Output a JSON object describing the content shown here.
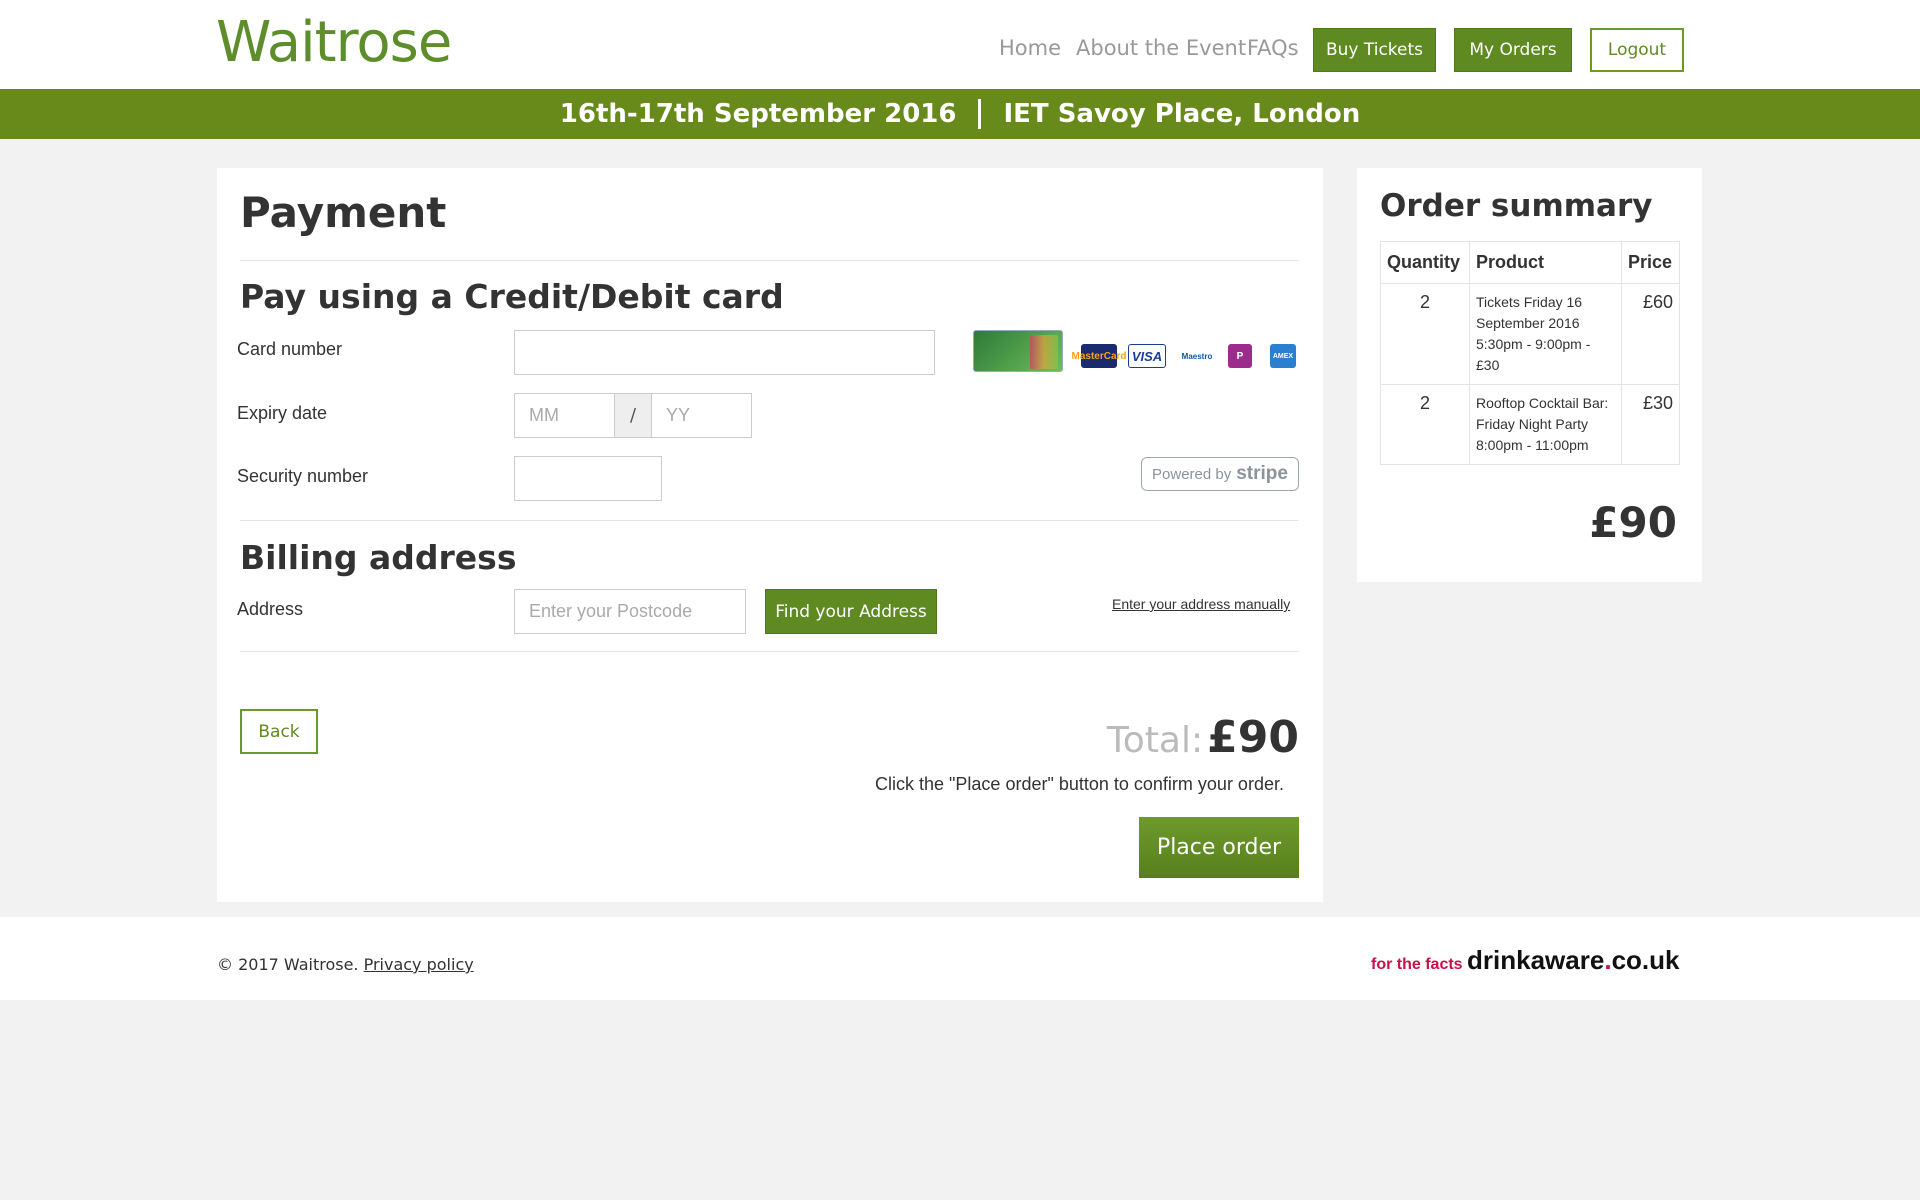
{
  "header": {
    "logo": "Waitrose",
    "nav": [
      "Home",
      "About the Event",
      "FAQs"
    ],
    "buy_tickets": "Buy Tickets",
    "my_orders": "My Orders",
    "logout": "Logout"
  },
  "banner": {
    "dates": "16th-17th September 2016",
    "venue": "IET Savoy Place, London"
  },
  "payment": {
    "title": "Payment",
    "card_heading": "Pay using a Credit/Debit card",
    "card_number_label": "Card number",
    "expiry_label": "Expiry date",
    "expiry_month_placeholder": "MM",
    "expiry_separator": "/",
    "expiry_year_placeholder": "YY",
    "security_label": "Security number",
    "card_icons": [
      "mastercard-icon",
      "visa-icon",
      "maestro-icon",
      "card-icon",
      "amex-icon"
    ],
    "card_icon_labels": [
      "MasterCard",
      "VISA",
      "Maestro",
      "P",
      "AMEX"
    ],
    "stripe_prefix": "Powered by",
    "stripe_name": "stripe",
    "billing_heading": "Billing address",
    "address_label": "Address",
    "postcode_placeholder": "Enter your Postcode",
    "find_address": "Find your Address",
    "manual_address": "Enter your address manually",
    "back": "Back",
    "total_label": "Total:",
    "total_value": "£90",
    "confirm_text": "Click the \"Place order\" button to confirm your order.",
    "place_order": "Place order"
  },
  "summary": {
    "title": "Order summary",
    "columns": [
      "Quantity",
      "Product",
      "Price"
    ],
    "rows": [
      {
        "qty": "2",
        "product": "Tickets Friday 16 September 2016 5:30pm - 9:00pm - £30",
        "price": "£60"
      },
      {
        "qty": "2",
        "product": "Rooftop Cocktail Bar: Friday Night Party 8:00pm - 11:00pm",
        "price": "£30"
      }
    ],
    "total": "£90"
  },
  "footer": {
    "copyright": "© 2017 Waitrose.",
    "privacy": "Privacy policy",
    "drinkaware_prefix": "for the facts",
    "drinkaware_name": "drinkaware",
    "drinkaware_dot": ".",
    "drinkaware_tld": "co.uk"
  },
  "colors": {
    "brand_green": "#5f8a22",
    "banner_green": "#678a1a"
  }
}
